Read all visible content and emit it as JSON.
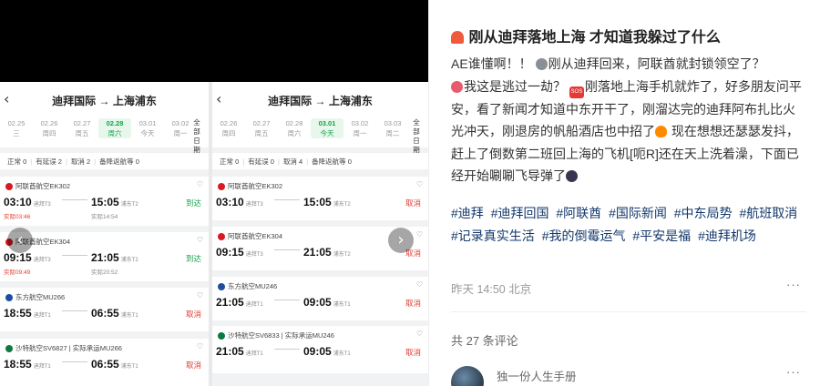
{
  "gallery": {
    "shot1": {
      "route": "迪拜国际 → 上海浦东",
      "dates": [
        {
          "d": "02.25",
          "w": "三"
        },
        {
          "d": "02.26",
          "w": "周四"
        },
        {
          "d": "02.27",
          "w": "周五"
        },
        {
          "d": "02.28",
          "w": "周六",
          "active": true
        },
        {
          "d": "03.01",
          "w": "今天"
        },
        {
          "d": "03.02",
          "w": "周一"
        }
      ],
      "all_dates": "全部日期",
      "filters": {
        "normal": "正常 0",
        "delay": "有延误 2",
        "cancel": "取消 2",
        "alt": "备降返航等 0"
      },
      "flights": [
        {
          "airline": "阿联酋航空EK302",
          "dep": "03:10",
          "dep_term": "迪拜T3",
          "arr": "15:05",
          "arr_term": "浦东T2",
          "mid": "当地 02.28",
          "status": "到达",
          "actual_dep": "实际03:46",
          "actual_arr": "实际14:54"
        },
        {
          "airline": "阿联酋航空EK304",
          "dep": "09:15",
          "dep_term": "迪拜T3",
          "arr": "21:05",
          "arr_term": "浦东T2",
          "mid": "当地 02.28",
          "status": "到达",
          "actual_dep": "实际09:49",
          "actual_arr": "实际20:52"
        },
        {
          "airline": "东方航空MU266",
          "dep": "18:55",
          "dep_term": "迪拜T1",
          "arr": "06:55",
          "arr_term": "浦东T1",
          "mid": "当地 03.01",
          "status": "取消"
        },
        {
          "airline": "沙特航空SV6827 | 实际承运MU266",
          "dep": "18:55",
          "dep_term": "迪拜T1",
          "arr": "06:55",
          "arr_term": "浦东T1",
          "mid": "当地 03.01",
          "status": "取消"
        }
      ]
    },
    "shot2": {
      "route": "迪拜国际 → 上海浦东",
      "dates": [
        {
          "d": "02.26",
          "w": "周四"
        },
        {
          "d": "02.27",
          "w": "周五"
        },
        {
          "d": "02.28",
          "w": "周六"
        },
        {
          "d": "03.01",
          "w": "今天",
          "active": true
        },
        {
          "d": "03.02",
          "w": "周一"
        },
        {
          "d": "03.03",
          "w": "周二"
        }
      ],
      "all_dates": "全部日期",
      "filters": {
        "normal": "正常 0",
        "delay": "有延误 0",
        "cancel": "取消 4",
        "alt": "备降返航等 0"
      },
      "flights": [
        {
          "airline": "阿联酋航空EK302",
          "dep": "03:10",
          "dep_term": "迪拜T3",
          "arr": "15:05",
          "arr_term": "浦东T2",
          "mid": "当地 03.01",
          "status": "取消"
        },
        {
          "airline": "阿联酋航空EK304",
          "dep": "09:15",
          "dep_term": "迪拜T3",
          "arr": "21:05",
          "arr_term": "浦东T2",
          "mid": "当地 03.01",
          "status": "取消"
        },
        {
          "airline": "东方航空MU246",
          "dep": "21:05",
          "dep_term": "迪拜T1",
          "arr": "09:05",
          "arr_term": "浦东T1",
          "mid": "当地 03.02",
          "status": "取消"
        },
        {
          "airline": "沙特航空SV6833 | 实际承运MU246",
          "dep": "21:05",
          "dep_term": "迪拜T1",
          "arr": "09:05",
          "arr_term": "浦东T1",
          "mid": "当地 03.02",
          "status": "取消"
        }
      ]
    }
  },
  "post": {
    "title": "刚从迪拜落地上海 才知道我躲过了什么",
    "paragraph_1": "AE谁懂啊！！",
    "paragraph_2": "刚从迪拜回来，阿联酋就封锁领空了？",
    "paragraph_3": "我这是逃过一劫？",
    "paragraph_4": "刚落地上海手机就炸了，好多朋友问平安，看了新闻才知道中东开干了，刚溜达完的迪拜阿布扎比火光冲天，刚退房的帆船酒店也中招了",
    "paragraph_5": "现在想想还瑟瑟发抖，赶上了倒数第二班回上海的飞机[呃R]还在天上洗着澡，下面已经开始唰唰飞导弹了",
    "emoji_sos": "SOS",
    "tags": [
      "#迪拜",
      "#迪拜回国",
      "#阿联酋",
      "#国际新闻",
      "#中东局势",
      "#航班取消",
      "#记录真实生活",
      "#我的倒霉运气",
      "#平安是福",
      "#迪拜机场"
    ],
    "time": "昨天 14:50 北京",
    "more": "···",
    "comments_count": "共 27 条评论",
    "comment_user": "独一份人生手册"
  },
  "colors": {
    "arrived": "#16a34a",
    "cancel": "#e03c31",
    "tag": "#13386c"
  }
}
